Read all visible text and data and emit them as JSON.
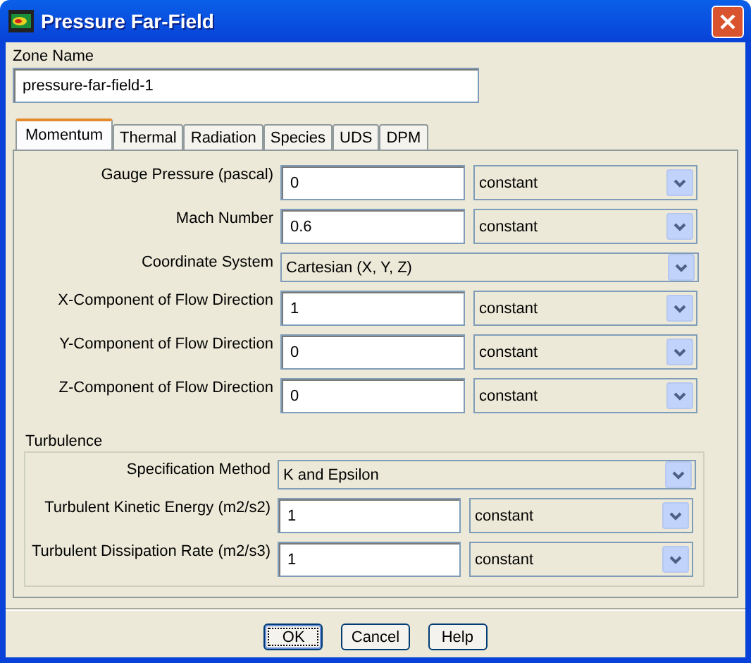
{
  "window": {
    "title": "Pressure Far-Field"
  },
  "zone_name": {
    "label": "Zone Name",
    "value": "pressure-far-field-1"
  },
  "tabs": [
    {
      "label": "Momentum",
      "selected": true
    },
    {
      "label": "Thermal",
      "selected": false
    },
    {
      "label": "Radiation",
      "selected": false
    },
    {
      "label": "Species",
      "selected": false
    },
    {
      "label": "UDS",
      "selected": false
    },
    {
      "label": "DPM",
      "selected": false
    }
  ],
  "momentum_rows": [
    {
      "kind": "field",
      "label": "Gauge Pressure (pascal)",
      "value": "0",
      "method": "constant"
    },
    {
      "kind": "field",
      "label": "Mach Number",
      "value": "0.6",
      "method": "constant"
    },
    {
      "kind": "combo",
      "label": "Coordinate System",
      "value": "Cartesian (X, Y, Z)"
    },
    {
      "kind": "field",
      "label": "X-Component of Flow Direction",
      "value": "1",
      "method": "constant"
    },
    {
      "kind": "field",
      "label": "Y-Component of Flow Direction",
      "value": "0",
      "method": "constant"
    },
    {
      "kind": "field",
      "label": "Z-Component of Flow Direction",
      "value": "0",
      "method": "constant"
    }
  ],
  "turbulence": {
    "title": "Turbulence",
    "rows": [
      {
        "kind": "combo",
        "label": "Specification Method",
        "value": "K and Epsilon"
      },
      {
        "kind": "field",
        "label": "Turbulent Kinetic Energy (m2/s2)",
        "value": "1",
        "method": "constant"
      },
      {
        "kind": "field",
        "label": "Turbulent Dissipation Rate (m2/s3)",
        "value": "1",
        "method": "constant"
      }
    ]
  },
  "buttons": [
    "OK",
    "Cancel",
    "Help"
  ]
}
